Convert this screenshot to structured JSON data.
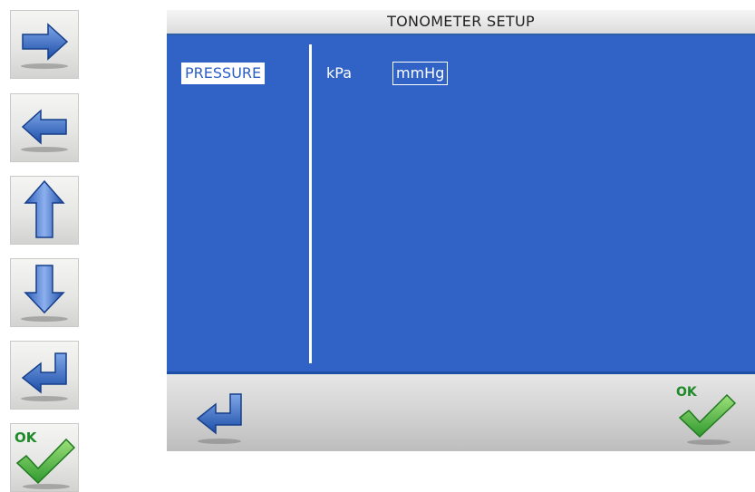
{
  "screen": {
    "title": "TONOMETER SETUP",
    "setting_label": "PRESSURE",
    "units": {
      "options": [
        "kPa",
        "mmHg"
      ],
      "selected": "mmHg"
    }
  },
  "keys": {
    "right_icon": "arrow-right-icon",
    "left_icon": "arrow-left-icon",
    "up_icon": "arrow-up-icon",
    "down_icon": "arrow-down-icon",
    "enter_icon": "return-icon",
    "ok_label": "OK"
  },
  "footer": {
    "back_icon": "return-icon",
    "ok_label": "OK"
  },
  "colors": {
    "screen_blue": "#3163c6",
    "arrow_blue": "#2f5fb8",
    "check_green": "#3aa53a",
    "ok_text_green": "#1f8a2a"
  }
}
